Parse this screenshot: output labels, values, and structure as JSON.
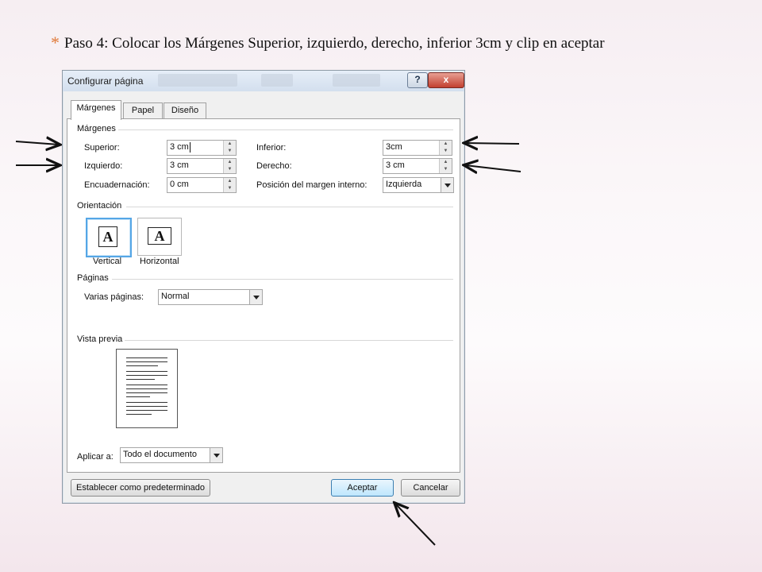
{
  "slide": {
    "bullet": "*",
    "instruction": "Paso 4: Colocar los Márgenes  Superior,  izquierdo,  derecho,  inferior 3cm y clip en aceptar"
  },
  "dialog": {
    "title": "Configurar página",
    "help_label": "?",
    "close_label": "x",
    "tabs": [
      "Márgenes",
      "Papel",
      "Diseño"
    ],
    "margins": {
      "section": "Márgenes",
      "superior": {
        "label": "Superior:",
        "value": "3 cm"
      },
      "inferior": {
        "label": "Inferior:",
        "value": "3cm"
      },
      "izquierdo": {
        "label": "Izquierdo:",
        "value": "3 cm"
      },
      "derecho": {
        "label": "Derecho:",
        "value": "3 cm"
      },
      "encuadernacion": {
        "label": "Encuadernación:",
        "value": "0 cm"
      },
      "posicion": {
        "label": "Posición del margen interno:",
        "value": "Izquierda"
      }
    },
    "orientation": {
      "section": "Orientación",
      "glyph": "A",
      "vertical": "Vertical",
      "horizontal": "Horizontal"
    },
    "pages": {
      "section": "Páginas",
      "label": "Varias páginas:",
      "value": "Normal"
    },
    "preview": {
      "section": "Vista previa"
    },
    "apply": {
      "label": "Aplicar a:",
      "value": "Todo el documento"
    },
    "buttons": {
      "default": "Establecer como predeterminado",
      "ok": "Aceptar",
      "cancel": "Cancelar"
    }
  },
  "colors": {
    "bullet": "#e07a3a",
    "selected_border": "#55a6e6",
    "primary_button": "#bee6fd"
  }
}
